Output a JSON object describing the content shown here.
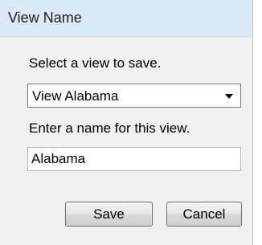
{
  "dialog": {
    "title": "View Name",
    "select_label": "Select a view to save.",
    "selected_view": "View Alabama",
    "name_label": "Enter a name for this view.",
    "name_value": "Alabama",
    "save_label": "Save",
    "cancel_label": "Cancel"
  },
  "icons": {
    "dropdown": "chevron-down-icon"
  },
  "colors": {
    "titlebar": "#dbe8f6",
    "dialog_bg": "#f0f0f0"
  }
}
